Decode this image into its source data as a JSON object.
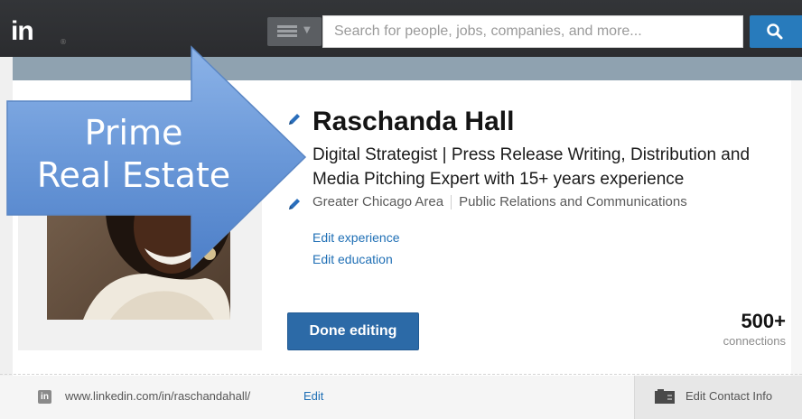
{
  "header": {
    "logo_text": "in",
    "logo_reg": "®",
    "search_placeholder": "Search for people, jobs, companies, and more...",
    "menu_icon": "hamburger-icon",
    "search_icon": "search-icon"
  },
  "profile": {
    "name": "Raschanda Hall",
    "headline": "Digital Strategist | Press Release Writing, Distribution and Media Pitching Expert with 15+ years experience",
    "location": "Greater Chicago Area",
    "industry": "Public Relations and Communications",
    "edit_experience": "Edit experience",
    "edit_education": "Edit education",
    "done_button": "Done editing",
    "connections_count": "500+",
    "connections_label": "connections"
  },
  "footer": {
    "public_url": "www.linkedin.com/in/raschandahall/",
    "url_edit": "Edit",
    "contact_button": "Edit Contact Info"
  },
  "callout": {
    "line1": "Prime",
    "line2": "Real Estate"
  },
  "colors": {
    "topbar": "#2d2e31",
    "accent_blue": "#287bbc",
    "link_blue": "#1f6fb5",
    "done_button": "#2c6aa7",
    "callout_blue": "#6d9ad8"
  }
}
